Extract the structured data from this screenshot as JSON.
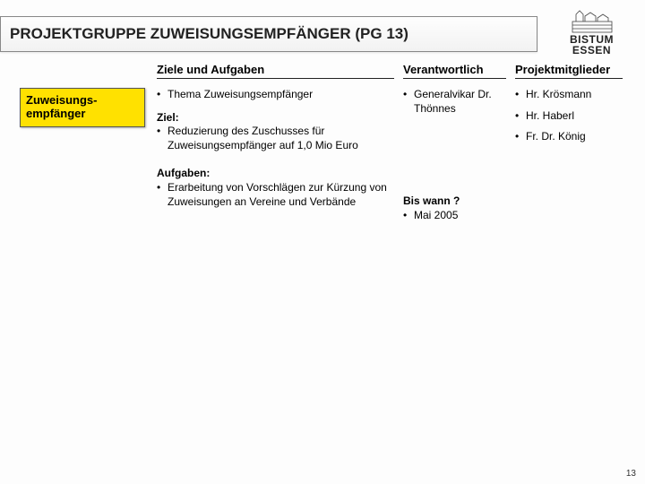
{
  "title": "PROJEKTGRUPPE ZUWEISUNGSEMPFÄNGER (PG 13)",
  "logo": {
    "line1": "BISTUM",
    "line2": "ESSEN"
  },
  "headers": {
    "col1": "Ziele und Aufgaben",
    "col2": "Verantwortlich",
    "col3": "Projektmitglieder"
  },
  "side_label": "Zuweisungs-empfänger",
  "col1": {
    "theme_bullet": "•",
    "theme_text": "Thema Zuweisungsempfänger",
    "ziel_label": "Ziel:",
    "ziel_bullet": "•",
    "ziel_text": "Reduzierung des Zuschusses für Zuweisungsempfänger auf 1,0 Mio Euro",
    "aufgaben_label": "Aufgaben:",
    "aufg_bullet": "•",
    "aufg_text": "Erarbeitung von Vorschlägen zur Kürzung von Zuweisungen an Vereine und Verbände"
  },
  "col2": {
    "resp_bullet": "•",
    "resp_text": "Generalvikar Dr. Thönnes",
    "biswann_label": "Bis wann ?",
    "bw_bullet": "•",
    "bw_text": "Mai 2005"
  },
  "col3": {
    "m1_bullet": "•",
    "m1_text": "Hr. Krösmann",
    "m2_bullet": "•",
    "m2_text": "Hr. Haberl",
    "m3_bullet": "•",
    "m3_text": "Fr. Dr. König"
  },
  "pagenum": "13"
}
